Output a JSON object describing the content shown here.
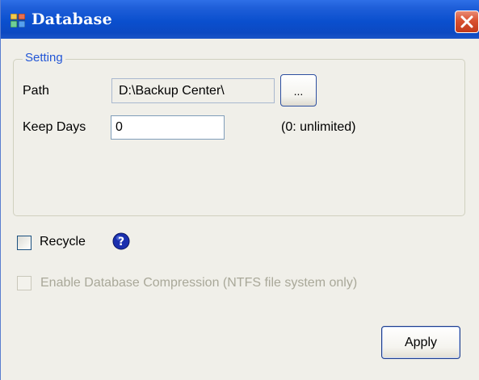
{
  "window": {
    "title": "Database"
  },
  "setting": {
    "legend": "Setting",
    "path_label": "Path",
    "path_value": "D:\\Backup Center\\",
    "browse_label": "...",
    "keep_days_label": "Keep Days",
    "keep_days_value": "0",
    "keep_days_hint": "(0: unlimited)"
  },
  "options": {
    "recycle_label": "Recycle",
    "recycle_checked": false,
    "compression_label": "Enable Database Compression (NTFS file system only)",
    "compression_enabled": false
  },
  "footer": {
    "apply_label": "Apply"
  },
  "colors": {
    "titlebar": "#0a4fce",
    "legend": "#2256d6",
    "close": "#d9512f",
    "disabled_text": "#a9a899"
  },
  "icons": {
    "window_icon": "database-app-icon",
    "close": "close-icon",
    "help": "help-icon"
  }
}
